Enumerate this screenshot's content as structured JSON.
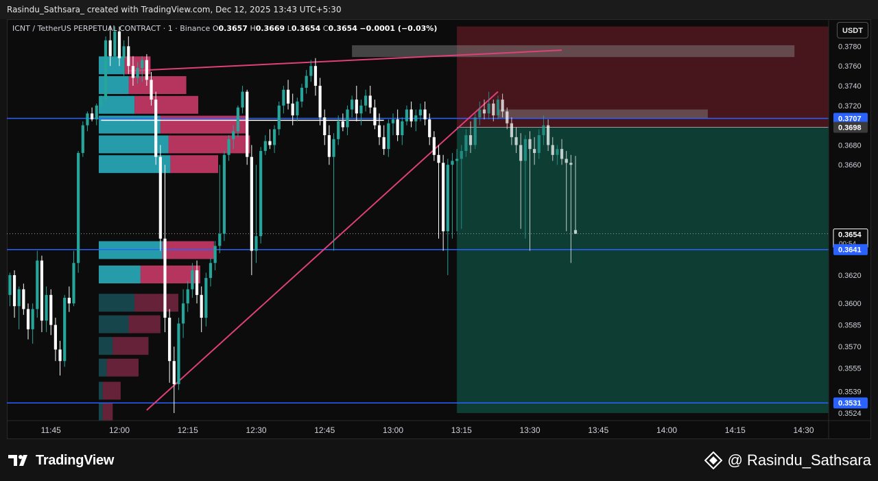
{
  "header": {
    "credit": "Rasindu_Sathsara_ created with TradingView.com, Dec 12, 2025 13:43 UTC+5:30"
  },
  "legend": {
    "symbol": "ICNT / TetherUS PERPETUAL CONTRACT · 1 · Binance",
    "o_label": "O",
    "o": "0.3657",
    "h_label": "H",
    "h": "0.3669",
    "l_label": "L",
    "l": "0.3654",
    "c_label": "C",
    "c": "0.3654",
    "change": "−0.0001 (−0.03%)"
  },
  "unit_button": "USDT",
  "footer": {
    "brand": "TradingView",
    "author": "@ Rasindu_Sathsara"
  },
  "icons": {
    "brand_icon": "tradingview-logo-icon",
    "author_icon": "binance-square-icon"
  },
  "colors": {
    "up": "#26a69a",
    "down": "#ffffff",
    "accent_line": "#e0407a",
    "level_line": "#2962ff",
    "profile_up": "#2bb5c6",
    "profile_down": "#d33d6e",
    "target_zone": "#0f4a3e",
    "stop_zone": "#5a1a22"
  },
  "chart_data": {
    "type": "candlestick",
    "time_labels": [
      "11:45",
      "12:00",
      "12:15",
      "12:30",
      "12:45",
      "13:00",
      "13:15",
      "13:30",
      "13:45",
      "14:00",
      "14:15",
      "14:30"
    ],
    "price_ticks": [
      "0.3780",
      "0.3760",
      "0.3740",
      "0.3720",
      "0.3680",
      "0.3660",
      "0.3620",
      "0.3600",
      "0.3585",
      "0.3570",
      "0.3555",
      "0.3539",
      "0.3524"
    ],
    "price_labels": [
      {
        "value": "0.3707",
        "style": "blue"
      },
      {
        "value": "0.3698",
        "style": "grey"
      },
      {
        "value": "0.3654",
        "style": "current",
        "countdown": "00:54"
      },
      {
        "value": "0.3641",
        "style": "blue"
      },
      {
        "value": "0.3531",
        "style": "blue"
      }
    ],
    "horizontal_levels": [
      {
        "price": 0.3707,
        "color": "#2962ff"
      },
      {
        "price": 0.3641,
        "color": "#2962ff"
      },
      {
        "price": 0.3531,
        "color": "#2962ff"
      },
      {
        "price": 0.3705,
        "color": "#ffffff",
        "from": "11:56",
        "to": "12:58"
      }
    ],
    "trend_lines": [
      {
        "from": [
          "12:02",
          0.3755
        ],
        "to": [
          "13:37",
          0.3776
        ]
      },
      {
        "from": [
          "12:06",
          0.3526
        ],
        "to": [
          "13:23",
          0.3734
        ]
      }
    ],
    "position_tool": {
      "type": "short",
      "entry": 0.3698,
      "stop": 0.38,
      "target": 0.3524,
      "from": "13:14",
      "to": "14:45"
    },
    "resistance_boxes": [
      {
        "from": "12:51",
        "to": "14:28",
        "top": 0.3781,
        "bottom": 0.3776
      },
      {
        "from": "13:23",
        "to": "14:09",
        "top": 0.3716,
        "bottom": 0.3714
      }
    ],
    "volume_profile": {
      "rows": [
        {
          "price": 0.376,
          "up": 26,
          "down": 26
        },
        {
          "price": 0.374,
          "up": 30,
          "down": 58
        },
        {
          "price": 0.372,
          "up": 36,
          "down": 64
        },
        {
          "price": 0.37,
          "up": 62,
          "down": 88
        },
        {
          "price": 0.368,
          "up": 70,
          "down": 82
        },
        {
          "price": 0.366,
          "up": 72,
          "down": 48
        },
        {
          "price": 0.364,
          "up": 64,
          "down": 52
        },
        {
          "price": 0.362,
          "up": 42,
          "down": 60
        },
        {
          "price": 0.36,
          "up": 36,
          "down": 44
        },
        {
          "price": 0.3585,
          "up": 30,
          "down": 32
        },
        {
          "price": 0.357,
          "up": 14,
          "down": 36
        },
        {
          "price": 0.3555,
          "up": 8,
          "down": 32
        },
        {
          "price": 0.3539,
          "up": 4,
          "down": 18
        },
        {
          "price": 0.3524,
          "up": 4,
          "down": 10
        }
      ]
    },
    "candles": [
      [
        "11:35",
        0.3616,
        0.3618,
        0.36,
        0.3606
      ],
      [
        "11:36",
        0.3606,
        0.3622,
        0.3598,
        0.362
      ],
      [
        "11:37",
        0.362,
        0.3624,
        0.359,
        0.3598
      ],
      [
        "11:38",
        0.3598,
        0.3612,
        0.3582,
        0.361
      ],
      [
        "11:39",
        0.361,
        0.3614,
        0.3592,
        0.3596
      ],
      [
        "11:40",
        0.3596,
        0.36,
        0.3575,
        0.3582
      ],
      [
        "11:41",
        0.3582,
        0.36,
        0.3572,
        0.3596
      ],
      [
        "11:42",
        0.3596,
        0.364,
        0.359,
        0.3632
      ],
      [
        "11:43",
        0.3632,
        0.3636,
        0.358,
        0.3588
      ],
      [
        "11:44",
        0.3588,
        0.3612,
        0.358,
        0.3606
      ],
      [
        "11:45",
        0.3606,
        0.361,
        0.3578,
        0.3585
      ],
      [
        "11:46",
        0.3585,
        0.359,
        0.356,
        0.3568
      ],
      [
        "11:47",
        0.3568,
        0.3574,
        0.355,
        0.356
      ],
      [
        "11:48",
        0.356,
        0.3606,
        0.3556,
        0.3604
      ],
      [
        "11:49",
        0.3604,
        0.3612,
        0.3594,
        0.36
      ],
      [
        "11:50",
        0.36,
        0.364,
        0.3598,
        0.363
      ],
      [
        "11:51",
        0.363,
        0.3674,
        0.3622,
        0.3672
      ],
      [
        "11:52",
        0.3672,
        0.3704,
        0.3668,
        0.37
      ],
      [
        "11:53",
        0.37,
        0.3714,
        0.3694,
        0.3712
      ],
      [
        "11:54",
        0.3712,
        0.3718,
        0.3704,
        0.3706
      ],
      [
        "11:55",
        0.3706,
        0.3722,
        0.37,
        0.372
      ],
      [
        "11:56",
        0.372,
        0.373,
        0.3716,
        0.3726
      ],
      [
        "11:57",
        0.3726,
        0.379,
        0.3722,
        0.3786
      ],
      [
        "11:58",
        0.3786,
        0.38,
        0.376,
        0.377
      ],
      [
        "11:59",
        0.377,
        0.38,
        0.3764,
        0.3795
      ],
      [
        "12:00",
        0.3795,
        0.38,
        0.376,
        0.3768
      ],
      [
        "12:01",
        0.3768,
        0.3786,
        0.375,
        0.378
      ],
      [
        "12:02",
        0.378,
        0.379,
        0.3752,
        0.376
      ],
      [
        "12:03",
        0.376,
        0.377,
        0.374,
        0.3748
      ],
      [
        "12:04",
        0.3748,
        0.3764,
        0.3742,
        0.3758
      ],
      [
        "12:05",
        0.3758,
        0.377,
        0.3744,
        0.3766
      ],
      [
        "12:06",
        0.3766,
        0.3772,
        0.374,
        0.3746
      ],
      [
        "12:07",
        0.3746,
        0.3754,
        0.372,
        0.3726
      ],
      [
        "12:08",
        0.3726,
        0.3734,
        0.366,
        0.3668
      ],
      [
        "12:09",
        0.3668,
        0.368,
        0.364,
        0.365
      ],
      [
        "12:10",
        0.365,
        0.366,
        0.358,
        0.359
      ],
      [
        "12:11",
        0.359,
        0.3596,
        0.3545,
        0.356
      ],
      [
        "12:12",
        0.356,
        0.357,
        0.3524,
        0.3544
      ],
      [
        "12:13",
        0.3544,
        0.359,
        0.354,
        0.3586
      ],
      [
        "12:14",
        0.3586,
        0.361,
        0.3576,
        0.36
      ],
      [
        "12:15",
        0.36,
        0.3616,
        0.3594,
        0.361
      ],
      [
        "12:16",
        0.361,
        0.363,
        0.3604,
        0.3624
      ],
      [
        "12:17",
        0.3624,
        0.3632,
        0.36,
        0.3606
      ],
      [
        "12:18",
        0.3606,
        0.3612,
        0.358,
        0.359
      ],
      [
        "12:19",
        0.359,
        0.3622,
        0.3584,
        0.3618
      ],
      [
        "12:20",
        0.3618,
        0.3634,
        0.3612,
        0.363
      ],
      [
        "12:21",
        0.363,
        0.3648,
        0.3624,
        0.3644
      ],
      [
        "12:22",
        0.3644,
        0.366,
        0.3638,
        0.3654
      ],
      [
        "12:23",
        0.3654,
        0.3674,
        0.3648,
        0.367
      ],
      [
        "12:24",
        0.367,
        0.369,
        0.3664,
        0.3686
      ],
      [
        "12:25",
        0.3686,
        0.37,
        0.3676,
        0.3694
      ],
      [
        "12:26",
        0.3694,
        0.372,
        0.3688,
        0.3718
      ],
      [
        "12:27",
        0.3718,
        0.374,
        0.3712,
        0.3734
      ],
      [
        "12:28",
        0.3734,
        0.3736,
        0.366,
        0.3668
      ],
      [
        "12:29",
        0.3668,
        0.368,
        0.362,
        0.364
      ],
      [
        "12:30",
        0.364,
        0.366,
        0.363,
        0.3652
      ],
      [
        "12:31",
        0.3652,
        0.3678,
        0.3646,
        0.3674
      ],
      [
        "12:32",
        0.3674,
        0.369,
        0.367,
        0.3684
      ],
      [
        "12:33",
        0.3684,
        0.3696,
        0.3676,
        0.368
      ],
      [
        "12:34",
        0.368,
        0.37,
        0.3672,
        0.3696
      ],
      [
        "12:35",
        0.3696,
        0.3724,
        0.369,
        0.372
      ],
      [
        "12:36",
        0.372,
        0.374,
        0.3712,
        0.3736
      ],
      [
        "12:37",
        0.3736,
        0.3746,
        0.3716,
        0.3722
      ],
      [
        "12:38",
        0.3722,
        0.3732,
        0.37,
        0.371
      ],
      [
        "12:39",
        0.371,
        0.3728,
        0.3704,
        0.3724
      ],
      [
        "12:40",
        0.3724,
        0.3742,
        0.3718,
        0.3738
      ],
      [
        "12:41",
        0.3738,
        0.3756,
        0.3732,
        0.375
      ],
      [
        "12:42",
        0.375,
        0.3766,
        0.3744,
        0.376
      ],
      [
        "12:43",
        0.376,
        0.3768,
        0.373,
        0.374
      ],
      [
        "12:44",
        0.374,
        0.3748,
        0.37,
        0.3708
      ],
      [
        "12:45",
        0.3708,
        0.3716,
        0.368,
        0.369
      ],
      [
        "12:46",
        0.369,
        0.37,
        0.366,
        0.3668
      ],
      [
        "12:47",
        0.3668,
        0.3692,
        0.364,
        0.3686
      ],
      [
        "12:48",
        0.3686,
        0.371,
        0.368,
        0.3704
      ],
      [
        "12:49",
        0.3704,
        0.3712,
        0.3694,
        0.3698
      ],
      [
        "12:50",
        0.3698,
        0.372,
        0.369,
        0.3716
      ],
      [
        "12:51",
        0.3716,
        0.373,
        0.3708,
        0.3726
      ],
      [
        "12:52",
        0.3726,
        0.374,
        0.3704,
        0.3712
      ],
      [
        "12:53",
        0.3712,
        0.3726,
        0.37,
        0.372
      ],
      [
        "12:54",
        0.372,
        0.3736,
        0.3714,
        0.373
      ],
      [
        "12:55",
        0.373,
        0.374,
        0.3712,
        0.3718
      ],
      [
        "12:56",
        0.3718,
        0.3726,
        0.3696,
        0.37
      ],
      [
        "12:57",
        0.37,
        0.3712,
        0.368,
        0.3688
      ],
      [
        "12:58",
        0.3688,
        0.37,
        0.367,
        0.3676
      ],
      [
        "12:59",
        0.3676,
        0.3706,
        0.3668,
        0.3702
      ],
      [
        "13:00",
        0.3702,
        0.3712,
        0.369,
        0.3706
      ],
      [
        "13:01",
        0.3706,
        0.3716,
        0.3684,
        0.369
      ],
      [
        "13:02",
        0.369,
        0.3708,
        0.368,
        0.3704
      ],
      [
        "13:03",
        0.3704,
        0.372,
        0.37,
        0.3716
      ],
      [
        "13:04",
        0.3716,
        0.3724,
        0.3698,
        0.3704
      ],
      [
        "13:05",
        0.3704,
        0.3716,
        0.3694,
        0.371
      ],
      [
        "13:06",
        0.371,
        0.3722,
        0.3704,
        0.3716
      ],
      [
        "13:07",
        0.3716,
        0.3724,
        0.37,
        0.3706
      ],
      [
        "13:08",
        0.3706,
        0.3712,
        0.368,
        0.3688
      ],
      [
        "13:09",
        0.3688,
        0.3694,
        0.3664,
        0.367
      ],
      [
        "13:10",
        0.367,
        0.368,
        0.365,
        0.3662
      ],
      [
        "13:11",
        0.3662,
        0.367,
        0.364,
        0.3656
      ],
      [
        "13:12",
        0.3656,
        0.3666,
        0.362,
        0.366
      ],
      [
        "13:13",
        0.366,
        0.3672,
        0.365,
        0.3664
      ],
      [
        "13:14",
        0.3664,
        0.3676,
        0.3656,
        0.3666
      ],
      [
        "13:15",
        0.3666,
        0.368,
        0.3658,
        0.3674
      ],
      [
        "13:16",
        0.3674,
        0.3696,
        0.3668,
        0.369
      ],
      [
        "13:17",
        0.369,
        0.3704,
        0.3672,
        0.368
      ],
      [
        "13:18",
        0.368,
        0.3712,
        0.3676,
        0.3708
      ],
      [
        "13:19",
        0.3708,
        0.3724,
        0.37,
        0.3716
      ],
      [
        "13:20",
        0.3716,
        0.3726,
        0.3706,
        0.3712
      ],
      [
        "13:21",
        0.3712,
        0.3734,
        0.3706,
        0.3722
      ],
      [
        "13:22",
        0.3722,
        0.3726,
        0.3704,
        0.371
      ],
      [
        "13:23",
        0.371,
        0.373,
        0.3706,
        0.3726
      ],
      [
        "13:24",
        0.3726,
        0.3732,
        0.3708,
        0.3714
      ],
      [
        "13:25",
        0.3714,
        0.3718,
        0.3696,
        0.3702
      ],
      [
        "13:26",
        0.3702,
        0.3708,
        0.368,
        0.3688
      ],
      [
        "13:27",
        0.3688,
        0.3698,
        0.3672,
        0.368
      ],
      [
        "13:28",
        0.368,
        0.3692,
        0.3658,
        0.3664
      ],
      [
        "13:29",
        0.3664,
        0.369,
        0.365,
        0.3686
      ],
      [
        "13:30",
        0.3686,
        0.3694,
        0.364,
        0.3676
      ],
      [
        "13:31",
        0.3676,
        0.3688,
        0.366,
        0.3672
      ],
      [
        "13:32",
        0.3672,
        0.3696,
        0.3666,
        0.369
      ],
      [
        "13:33",
        0.369,
        0.371,
        0.368,
        0.37
      ],
      [
        "13:34",
        0.37,
        0.3706,
        0.3674,
        0.368
      ],
      [
        "13:35",
        0.368,
        0.3688,
        0.3664,
        0.367
      ],
      [
        "13:36",
        0.367,
        0.368,
        0.366,
        0.3676
      ],
      [
        "13:37",
        0.3676,
        0.3686,
        0.366,
        0.3666
      ],
      [
        "13:38",
        0.3666,
        0.3674,
        0.3656,
        0.3662
      ],
      [
        "13:39",
        0.3662,
        0.367,
        0.363,
        0.366
      ],
      [
        "13:40",
        0.3657,
        0.3669,
        0.3654,
        0.3654
      ]
    ]
  }
}
